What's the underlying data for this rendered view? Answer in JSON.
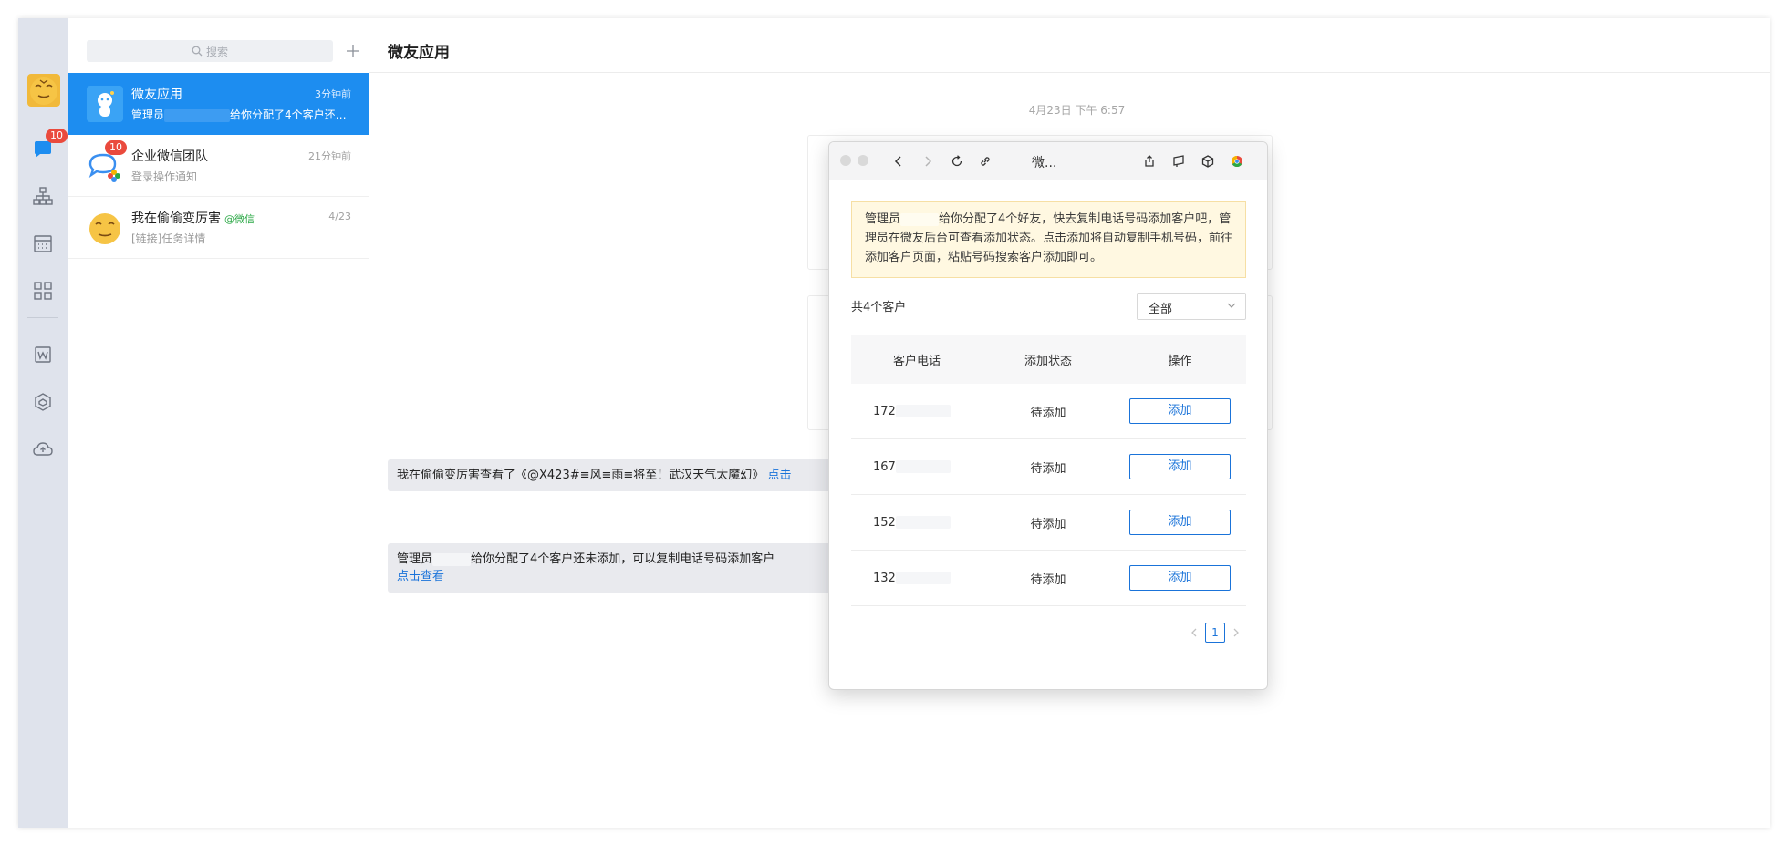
{
  "sidebar": {
    "chat_badge": "10"
  },
  "list": {
    "search_placeholder": "搜索",
    "conversations": [
      {
        "title": "微友应用",
        "time": "3分钟前",
        "sub_prefix": "管理员",
        "sub_suffix": "给你分配了4个客户还未添..."
      },
      {
        "title": "企业微信团队",
        "time": "21分钟前",
        "sub": "登录操作通知",
        "badge": "10"
      },
      {
        "title": "我在偷偷变厉害",
        "tag": "@微信",
        "time": "4/23",
        "sub": "[链接]任务详情"
      }
    ]
  },
  "main": {
    "title": "微友应用",
    "timestamp": "4月23日 下午 6:57",
    "msg1_text": "我在偷偷变厉害查看了《@X423#≡风≡雨≡将至！武汉天气太魔幻》",
    "msg1_link": "点击",
    "msg2_prefix": "管理员",
    "msg2_text": "给你分配了4个客户还未添加，可以复制电话号码添加客户",
    "msg2_link": "点击查看"
  },
  "popup": {
    "title": "微...",
    "notice_prefix": "管理员",
    "notice_text": "给你分配了4个好友，快去复制电话号码添加客户吧，管理员在微友后台可查看添加状态。点击添加将自动复制手机号码，前往添加客户页面，粘贴号码搜索客户添加即可。",
    "count_label": "共4个客户",
    "filter_value": "全部",
    "columns": [
      "客户电话",
      "添加状态",
      "操作"
    ],
    "rows": [
      {
        "phone": "172",
        "status": "待添加",
        "action": "添加"
      },
      {
        "phone": "167",
        "status": "待添加",
        "action": "添加"
      },
      {
        "phone": "152",
        "status": "待添加",
        "action": "添加"
      },
      {
        "phone": "132",
        "status": "待添加",
        "action": "添加"
      }
    ],
    "page": "1"
  },
  "colors": {
    "accent": "#1d8df0",
    "link": "#1a73d9",
    "badge": "#ea4a3d",
    "rail": "#dfe3ec"
  }
}
